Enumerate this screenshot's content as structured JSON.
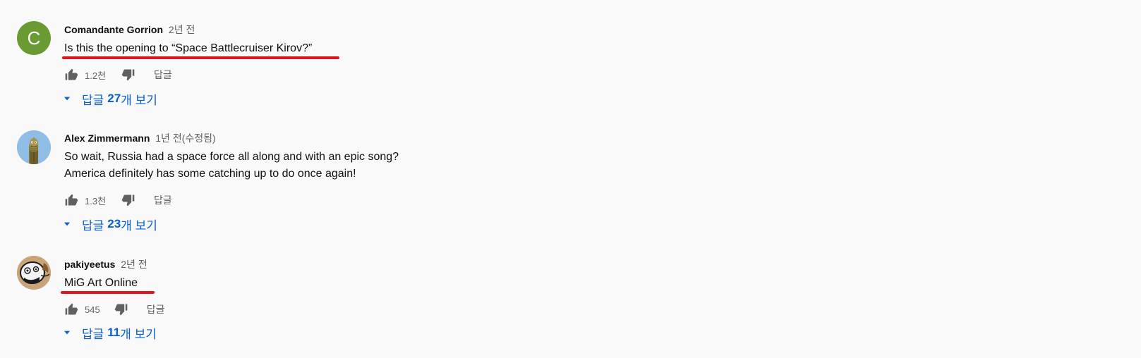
{
  "comments": [
    {
      "author": "Comandante Gorrion",
      "time": "2년 전",
      "edited": "",
      "avatar": {
        "type": "letter",
        "letter": "C",
        "color": "#6a9a32"
      },
      "text_lines": [
        "Is this the opening to “Space Battlecruiser Kirov?”"
      ],
      "underlined": true,
      "likes": "1.2천",
      "reply_label": "답글",
      "view_replies": {
        "prefix": "답글",
        "count": "27",
        "suffix": "개 보기"
      }
    },
    {
      "author": "Alex Zimmermann",
      "time": "1년 전",
      "edited": "(수정됨)",
      "avatar": {
        "type": "image",
        "icon": "cartoon-character-icon"
      },
      "text_lines": [
        "So wait, Russia had a space force all along and with an epic song?",
        "America definitely has some catching up to do once again!"
      ],
      "underlined": false,
      "likes": "1.3천",
      "reply_label": "답글",
      "view_replies": {
        "prefix": "답글",
        "count": "23",
        "suffix": "개 보기"
      }
    },
    {
      "author": "pakiyeetus",
      "time": "2년 전",
      "edited": "",
      "avatar": {
        "type": "image",
        "icon": "cartoon-face-icon"
      },
      "text_lines": [
        "MiG Art Online"
      ],
      "underlined": true,
      "likes": "545",
      "reply_label": "답글",
      "view_replies": {
        "prefix": "답글",
        "count": "11",
        "suffix": "개 보기"
      }
    }
  ],
  "colors": {
    "background": "#f9f9f9",
    "link": "#065fd4",
    "underline_annotation": "#e0141e",
    "secondary_text": "#606060"
  },
  "icons": {
    "like": "thumbs-up-icon",
    "dislike": "thumbs-down-icon",
    "expand": "caret-down-icon"
  }
}
